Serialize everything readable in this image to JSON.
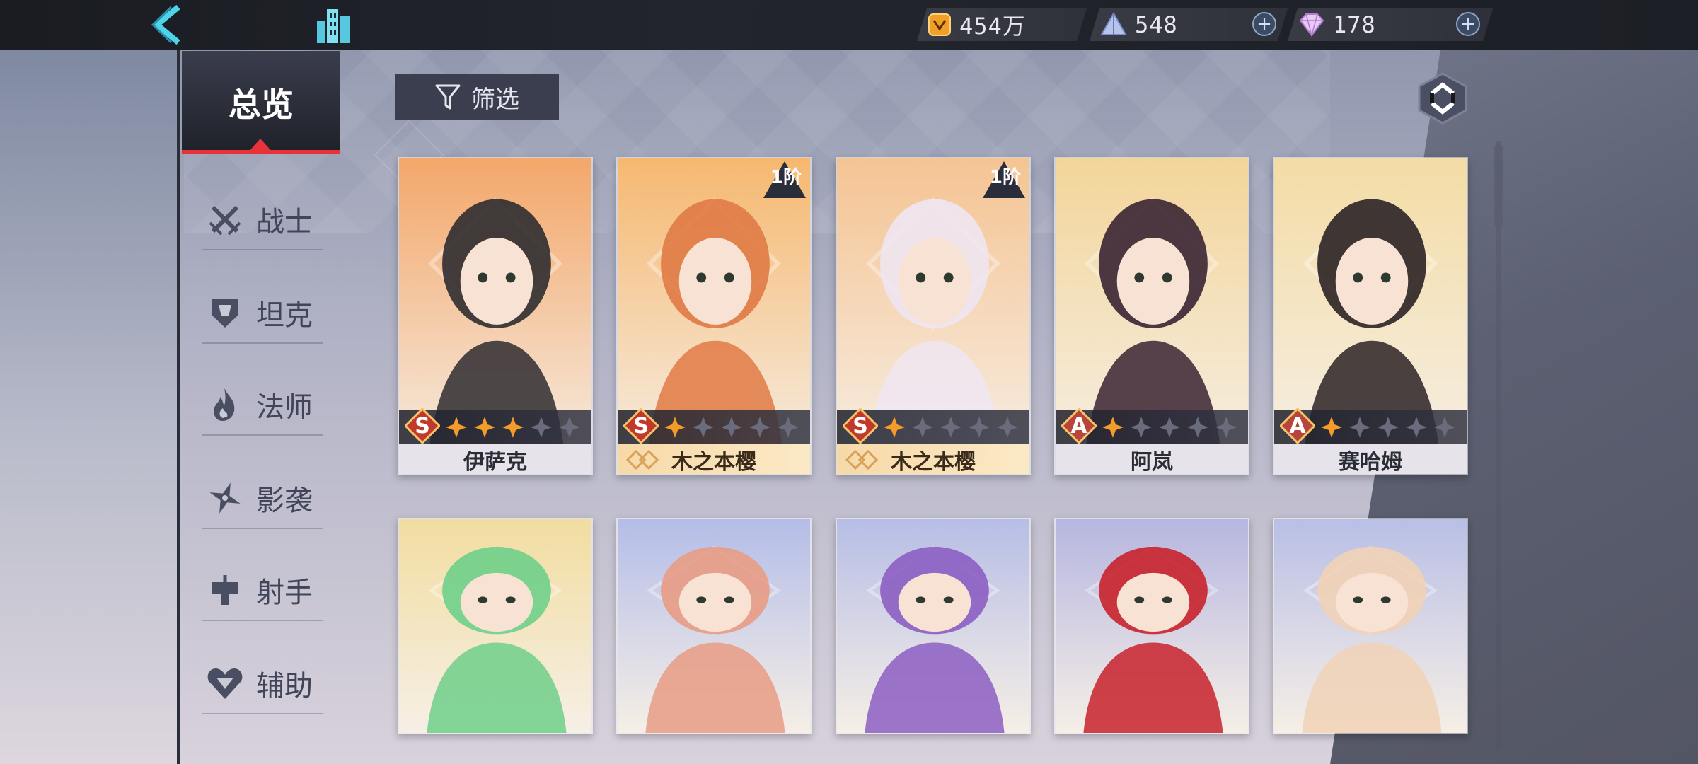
{
  "topbar": {
    "back_icon": "back-arrow-icon",
    "city_icon": "city-buildings-icon",
    "gold": "454万",
    "crystal": "548",
    "gems": "178",
    "plus_label": "+"
  },
  "sidebar": {
    "overview_label": "总览",
    "categories": [
      {
        "label": "战士",
        "icon": "crossed-swords-icon"
      },
      {
        "label": "坦克",
        "icon": "shield-helmet-icon"
      },
      {
        "label": "法师",
        "icon": "flame-icon"
      },
      {
        "label": "影袭",
        "icon": "shuriken-icon"
      },
      {
        "label": "射手",
        "icon": "crosshair-icon"
      },
      {
        "label": "辅助",
        "icon": "heart-icon"
      }
    ]
  },
  "toolbar": {
    "filter_label": "筛选",
    "refresh_icon": "refresh-icon"
  },
  "cards": [
    {
      "name": "伊萨克",
      "rank": "S",
      "stars_filled": 3,
      "stars_total": 5,
      "tier": "",
      "collab": false,
      "palette": [
        "#f3a76a",
        "#2f2c30"
      ]
    },
    {
      "name": "木之本樱",
      "rank": "S",
      "stars_filled": 1,
      "stars_total": 5,
      "tier": "1阶",
      "collab": true,
      "palette": [
        "#f6b870",
        "#e07a45"
      ]
    },
    {
      "name": "木之本樱",
      "rank": "S",
      "stars_filled": 1,
      "stars_total": 5,
      "tier": "1阶",
      "collab": true,
      "palette": [
        "#f5c493",
        "#f0e6f2"
      ]
    },
    {
      "name": "阿岚",
      "rank": "A",
      "stars_filled": 1,
      "stars_total": 5,
      "tier": "",
      "collab": false,
      "palette": [
        "#f3d59a",
        "#3a2333"
      ]
    },
    {
      "name": "赛哈姆",
      "rank": "A",
      "stars_filled": 1,
      "stars_total": 5,
      "tier": "",
      "collab": false,
      "palette": [
        "#f3dca5",
        "#2b2225"
      ]
    },
    {
      "name": "",
      "rank": "",
      "stars_filled": 0,
      "stars_total": 0,
      "tier": "",
      "collab": false,
      "palette": [
        "#f2dda0",
        "#6fcf8a"
      ]
    },
    {
      "name": "",
      "rank": "",
      "stars_filled": 0,
      "stars_total": 0,
      "tier": "",
      "collab": false,
      "palette": [
        "#b4bde8",
        "#e89c84"
      ]
    },
    {
      "name": "",
      "rank": "",
      "stars_filled": 0,
      "stars_total": 0,
      "tier": "",
      "collab": false,
      "palette": [
        "#b7bee6",
        "#8c5ec2"
      ]
    },
    {
      "name": "",
      "rank": "",
      "stars_filled": 0,
      "stars_total": 0,
      "tier": "",
      "collab": false,
      "palette": [
        "#b6b6e0",
        "#c8222c"
      ]
    },
    {
      "name": "",
      "rank": "",
      "stars_filled": 0,
      "stars_total": 0,
      "tier": "",
      "collab": false,
      "palette": [
        "#b9bfe6",
        "#f1d2b6"
      ]
    }
  ],
  "colors": {
    "accent_red": "#e8323a",
    "rank_s": "#c0392b",
    "rank_a": "#b8443a",
    "star_on": "#f39c2b",
    "star_off": "#6a6c7e"
  }
}
